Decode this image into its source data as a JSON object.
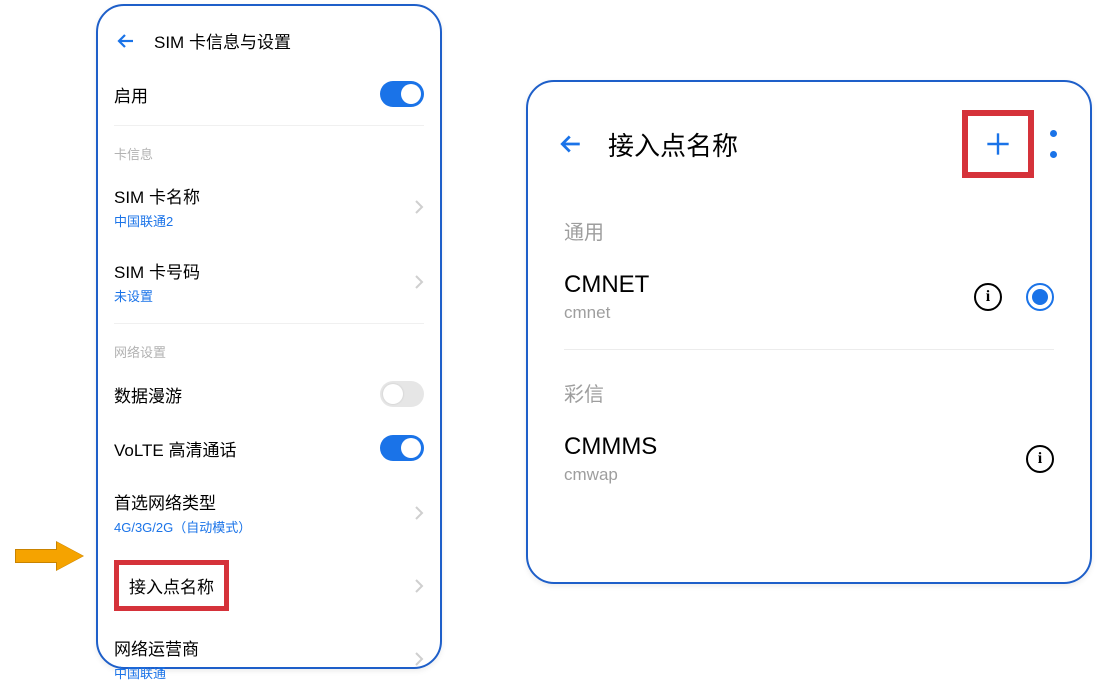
{
  "left": {
    "title": "SIM 卡信息与设置",
    "enable": {
      "label": "启用",
      "on": true
    },
    "section_card": "卡信息",
    "sim_name": {
      "label": "SIM 卡名称",
      "value": "中国联通2"
    },
    "sim_number": {
      "label": "SIM 卡号码",
      "value": "未设置"
    },
    "section_net": "网络设置",
    "roaming": {
      "label": "数据漫游",
      "on": false
    },
    "volte": {
      "label": "VoLTE 高清通话",
      "on": true
    },
    "pref_net": {
      "label": "首选网络类型",
      "value": "4G/3G/2G（自动模式）"
    },
    "apn": {
      "label": "接入点名称"
    },
    "carrier": {
      "label": "网络运营商",
      "value": "中国联通"
    }
  },
  "right": {
    "title": "接入点名称",
    "section_general": "通用",
    "apn1": {
      "name": "CMNET",
      "value": "cmnet",
      "selected": true
    },
    "section_mms": "彩信",
    "apn2": {
      "name": "CMMMS",
      "value": "cmwap",
      "selected": false
    }
  }
}
